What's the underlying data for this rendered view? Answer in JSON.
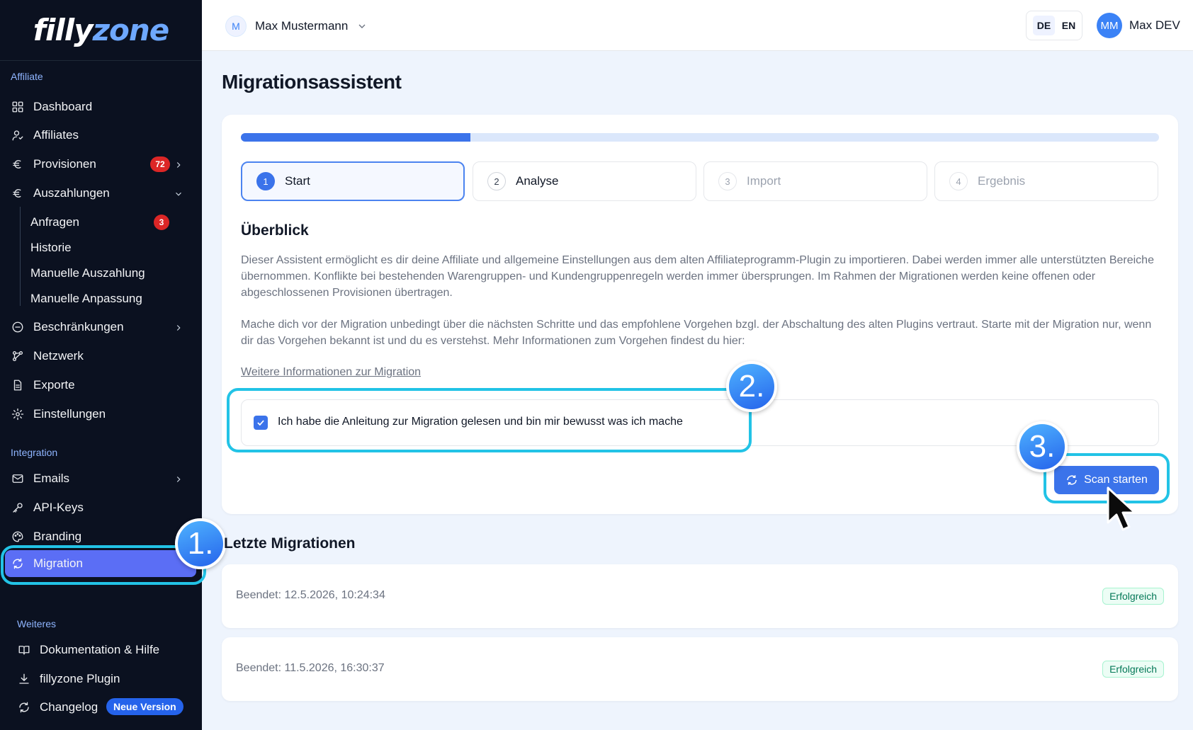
{
  "app": {
    "logo_left": "filly",
    "logo_right": "zone"
  },
  "sidebar": {
    "section_affiliate": "Affiliate",
    "section_integration": "Integration",
    "section_more": "Weiteres",
    "items": {
      "dashboard": "Dashboard",
      "affiliates": "Affiliates",
      "provisionen": "Provisionen",
      "provisionen_badge": "72",
      "auszahlungen": "Auszahlungen",
      "anfragen": "Anfragen",
      "anfragen_badge": "3",
      "historie": "Historie",
      "manuelle_auszahlung": "Manuelle Auszahlung",
      "manuelle_anpassung": "Manuelle Anpassung",
      "beschraenkungen": "Beschränkungen",
      "netzwerk": "Netzwerk",
      "exporte": "Exporte",
      "einstellungen": "Einstellungen",
      "emails": "Emails",
      "api_keys": "API-Keys",
      "branding": "Branding",
      "migration": "Migration",
      "doku": "Dokumentation & Hilfe",
      "plugin": "fillyzone Plugin",
      "changelog": "Changelog",
      "changelog_badge": "Neue Version"
    }
  },
  "header": {
    "user_initial": "M",
    "user_name": "Max Mustermann",
    "lang_de": "DE",
    "lang_en": "EN",
    "account_initials": "MM",
    "account_name": "Max DEV"
  },
  "main": {
    "title": "Migrationsassistent",
    "progress_fraction": 0.25,
    "steps": [
      {
        "num": "1",
        "label": "Start"
      },
      {
        "num": "2",
        "label": "Analyse"
      },
      {
        "num": "3",
        "label": "Import"
      },
      {
        "num": "4",
        "label": "Ergebnis"
      }
    ],
    "overview_title": "Überblick",
    "para1": "Dieser Assistent ermöglicht es dir deine Affiliate und allgemeine Einstellungen aus dem alten Affiliateprogramm-Plugin zu importieren. Dabei werden immer alle unterstützten Bereiche übernommen. Konflikte bei bestehenden Warengruppen- und Kundengruppenregeln werden immer übersprungen. Im Rahmen der Migrationen werden keine offenen oder abgeschlossenen Provisionen übertragen.",
    "para2": "Mache dich vor der Migration unbedingt über die nächsten Schritte und das empfohlene Vorgehen bzgl. der Abschaltung des alten Plugins vertraut. Starte mit der Migration nur, wenn dir das Vorgehen bekannt ist und du es verstehst. Mehr Informationen zum Vorgehen findest du hier:",
    "link": "Weitere Informationen zur Migration",
    "checkbox_label": "Ich habe die Anleitung zur Migration gelesen und bin mir bewusst was ich mache",
    "scan_button": "Scan starten",
    "last_title": "Letzte Migrationen",
    "migrations": [
      {
        "text": "Beendet: 12.5.2026, 10:24:34",
        "status": "Erfolgreich"
      },
      {
        "text": "Beendet: 11.5.2026, 16:30:37",
        "status": "Erfolgreich"
      }
    ]
  },
  "annotations": {
    "one": "1.",
    "two": "2.",
    "three": "3."
  },
  "colors": {
    "accent": "#3b73ea",
    "highlight": "#22c3e6",
    "sidebar_bg": "#0b1120",
    "active_nav": "#5b6ef5"
  }
}
